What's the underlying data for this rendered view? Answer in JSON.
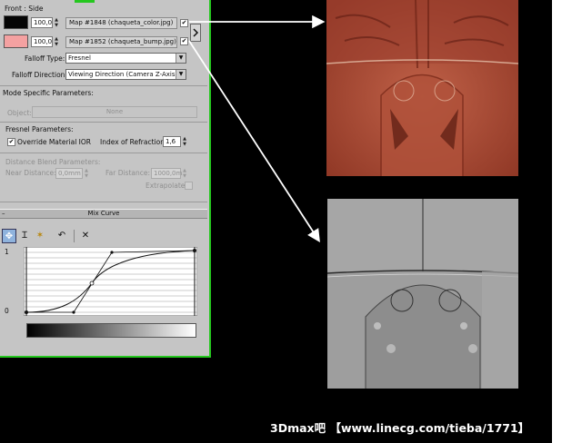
{
  "panel": {
    "header_label": "Front : Side",
    "slot1": {
      "amount": "100,0",
      "map": "Map #1848 (chaqueta_color.jpg)",
      "swatch_color": "#050505"
    },
    "slot2": {
      "amount": "100,0",
      "map": "Map #1852 (chaqueta_bump.jpg)",
      "swatch_color": "#f4a1a1"
    },
    "falloff_type_label": "Falloff Type:",
    "falloff_type_value": "Fresnel",
    "falloff_dir_label": "Falloff Direction:",
    "falloff_dir_value": "Viewing Direction (Camera Z-Axis)",
    "mode_title": "Mode Specific Parameters:",
    "object_label": "Object:",
    "object_value": "None",
    "fresnel_title": "Fresnel Parameters:",
    "override_label": "Override Material IOR",
    "ior_label": "Index of Refraction",
    "ior_value": "1,6",
    "distance_title": "Distance Blend Parameters:",
    "near_label": "Near Distance:",
    "near_value": "0,0mm",
    "far_label": "Far Distance:",
    "far_value": "1000,0m",
    "extrapolate_label": "Extrapolate",
    "mix_curve_label": "Mix Curve",
    "graph_top_label": "1",
    "graph_bottom_label": "0"
  },
  "watermark": "3Dmax吧 【www.linecg.com/tieba/1771】",
  "colors": {
    "accent_border": "#25c71f",
    "panel_bg": "#c5c5c5"
  }
}
